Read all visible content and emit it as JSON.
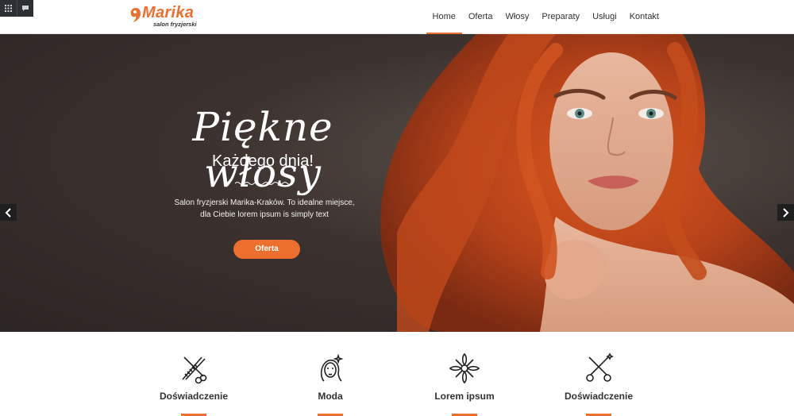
{
  "brand": {
    "name": "Marika",
    "tagline": "salon fryzjerski",
    "accent": "#ec6f2e"
  },
  "admin_bar": {
    "icons": [
      "grid-icon",
      "comment-icon"
    ]
  },
  "nav": {
    "items": [
      {
        "label": "Home",
        "active": true
      },
      {
        "label": "Oferta",
        "active": false
      },
      {
        "label": "Włosy",
        "active": false
      },
      {
        "label": "Preparaty",
        "active": false
      },
      {
        "label": "Usługi",
        "active": false
      },
      {
        "label": "Kontakt",
        "active": false
      }
    ]
  },
  "hero": {
    "script_title": "Piękne włosy",
    "subtitle": "Każdego dnia!",
    "description_line1": "Salon fryzjerski Marika-Kraków. To idealne miejsce,",
    "description_line2": "dla Ciebie lorem ipsum is simply text",
    "button_label": "Oferta",
    "prev_icon": "chevron-left-icon",
    "next_icon": "chevron-right-icon"
  },
  "features": [
    {
      "title": "Doświadczenie",
      "icon": "scissors-comb-icon"
    },
    {
      "title": "Moda",
      "icon": "woman-hair-icon"
    },
    {
      "title": "Lorem ipsum",
      "icon": "flower-icon"
    },
    {
      "title": "Doświadczenie",
      "icon": "crossed-scissors-icon"
    }
  ]
}
